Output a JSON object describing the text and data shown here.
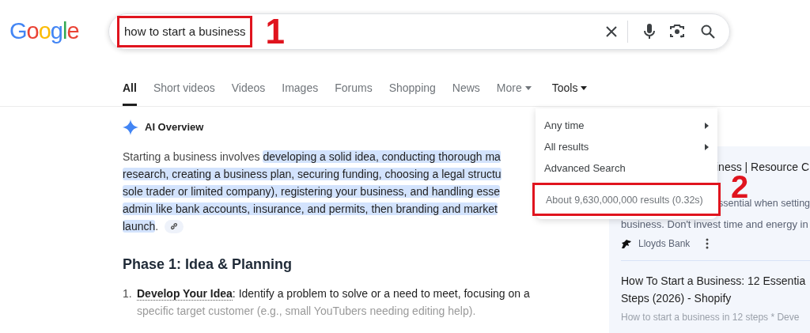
{
  "logo": "Google",
  "search": {
    "value": "how to start a business"
  },
  "tabs": [
    {
      "label": "All",
      "selected": true,
      "kind": "tab"
    },
    {
      "label": "Short videos",
      "selected": false,
      "kind": "tab"
    },
    {
      "label": "Videos",
      "selected": false,
      "kind": "tab"
    },
    {
      "label": "Images",
      "selected": false,
      "kind": "tab"
    },
    {
      "label": "Forums",
      "selected": false,
      "kind": "tab"
    },
    {
      "label": "Shopping",
      "selected": false,
      "kind": "tab"
    },
    {
      "label": "News",
      "selected": false,
      "kind": "tab"
    },
    {
      "label": "More",
      "selected": false,
      "kind": "dropdown",
      "expanded": false
    },
    {
      "label": "Tools",
      "selected": false,
      "kind": "dropdown",
      "expanded": true
    }
  ],
  "tools_menu": {
    "items": [
      {
        "label": "Any time",
        "submenu": true
      },
      {
        "label": "All results",
        "submenu": true
      },
      {
        "label": "Advanced Search",
        "submenu": false
      }
    ],
    "result_stats": "About 9,630,000,000 results (0.32s)"
  },
  "ai_overview": {
    "title": "AI Overview",
    "lines": [
      [
        {
          "text": "Starting a business involves ",
          "highlighted": false
        },
        {
          "text": "developing a solid idea, conducting thorough ma",
          "highlighted": true
        }
      ],
      [
        {
          "text": "research, creating a business plan, securing funding, choosing a legal structu",
          "highlighted": true
        }
      ],
      [
        {
          "text": "sole trader or limited company), registering your business, and handling esse",
          "highlighted": true
        }
      ],
      [
        {
          "text": "admin like bank accounts, insurance, and permits, then branding and market",
          "highlighted": true
        }
      ],
      [
        {
          "text": "launch",
          "highlighted": true
        },
        {
          "text": ".",
          "highlighted": false
        }
      ]
    ],
    "heading": "Phase 1: Idea & Planning",
    "steps": [
      {
        "number": "1.",
        "term": "Develop Your Idea",
        "lines": [
          ": Identify a problem to solve or a need to meet, focusing on a",
          "specific target customer (e.g., small YouTubers needing editing help)."
        ]
      }
    ]
  },
  "side_results": [
    {
      "title": "iness | Resource C",
      "snippet": [
        "ssential when setting",
        "business. Don't invest time and energy in"
      ],
      "source": "Lloyds Bank"
    },
    {
      "title": [
        "How To Start a Business: 12 Essentia",
        "Steps (2026) - Shopify"
      ],
      "snippet": [
        "How to start a business in 12 steps * Deve"
      ]
    }
  ],
  "annotations": [
    {
      "label": "1"
    },
    {
      "label": "2"
    }
  ]
}
